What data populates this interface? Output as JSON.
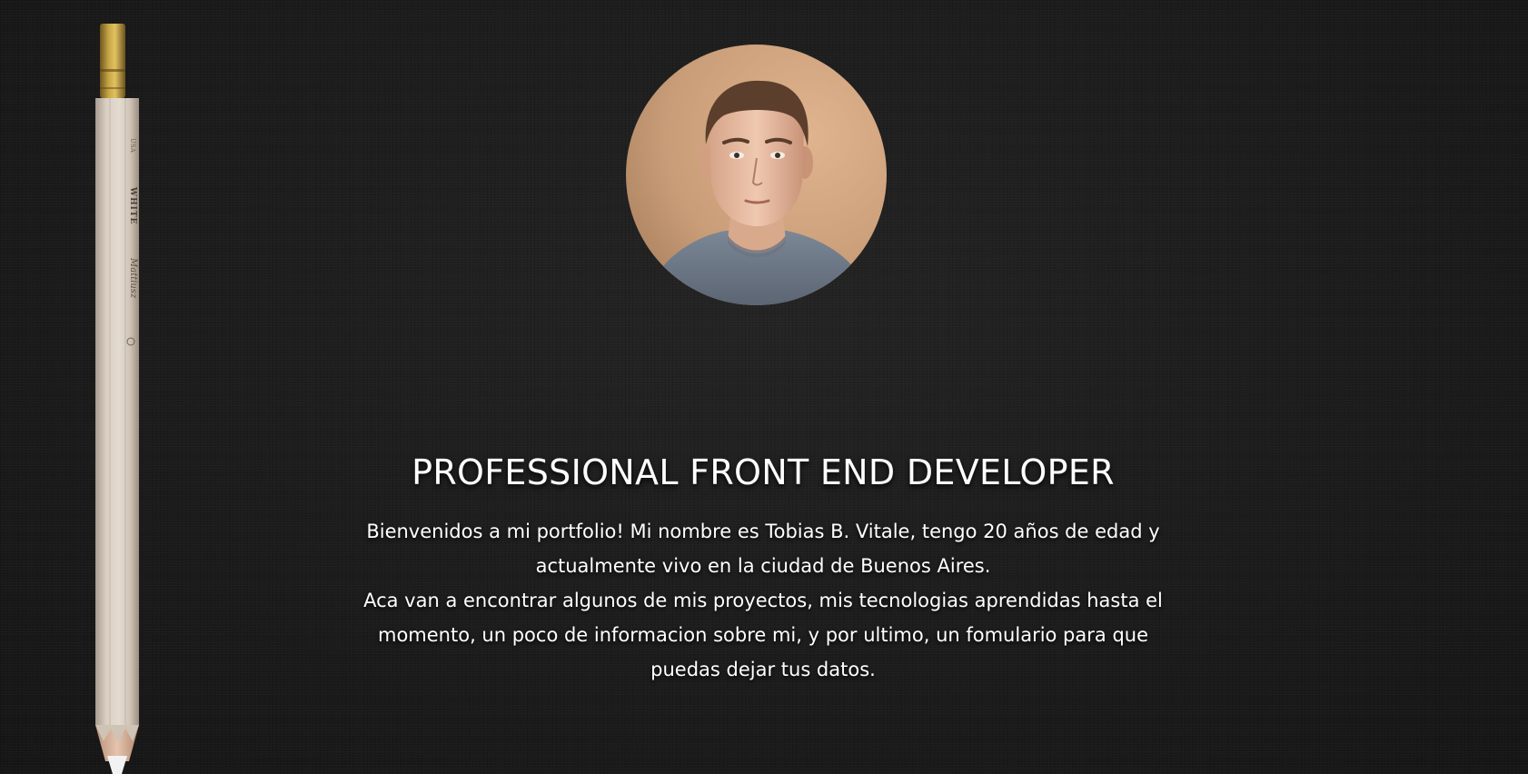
{
  "hero": {
    "title": "PROFESSIONAL FRONT END DEVELOPER",
    "bio": [
      "Bienvenidos a mi portfolio! Mi nombre es Tobias B. Vitale, tengo 20 años de edad y actualmente vivo en la ciudad de Buenos Aires.",
      "Aca van a encontrar algunos de mis proyectos, mis tecnologias aprendidas hasta el momento, un poco de informacion sobre mi, y por ultimo, un fomulario para que puedas dejar tus datos."
    ]
  },
  "pencil": {
    "brand_text": "Mattiusz",
    "color_text": "WHITE",
    "code_text": "USA"
  },
  "colors": {
    "background": "#1c1c1c",
    "text": "#ffffff",
    "pencil_body": "#d6cbbf",
    "pencil_ferrule": "#a88a3c",
    "photo_background": "#c9a07a"
  }
}
